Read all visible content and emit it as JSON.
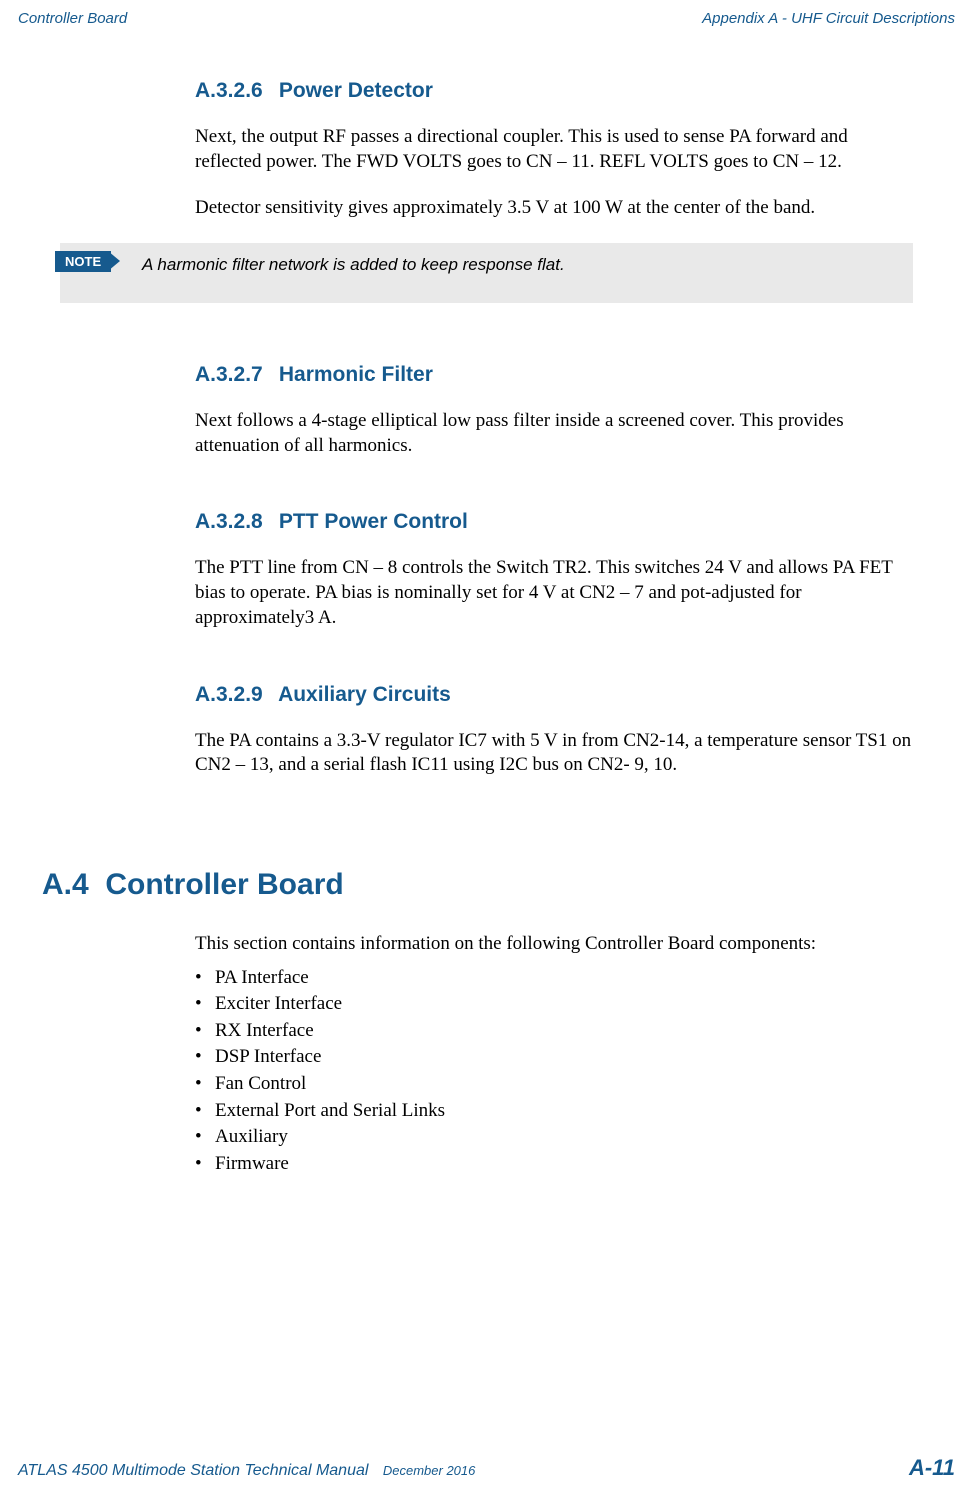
{
  "header": {
    "left": "Controller Board",
    "right": "Appendix A - UHF Circuit Descriptions"
  },
  "sections": {
    "s1": {
      "num": "A.3.2.6",
      "title": "Power Detector",
      "p1": "Next, the output RF passes a directional coupler. This is used to sense PA forward and reflected power. The FWD VOLTS goes to CN – 11. REFL VOLTS goes to CN – 12.",
      "p2": "Detector sensitivity gives approximately 3.5 V at 100 W at the center of the band."
    },
    "note": {
      "label": "NOTE",
      "text": "A harmonic filter network is added to keep response flat."
    },
    "s2": {
      "num": "A.3.2.7",
      "title": "Harmonic Filter",
      "p1": "Next follows a 4-stage elliptical low pass filter inside a screened cover. This provides attenuation of all harmonics."
    },
    "s3": {
      "num": "A.3.2.8",
      "title": "PTT Power Control",
      "p1": "The PTT line from CN – 8 controls the Switch TR2. This switches 24 V and allows PA FET bias to operate. PA bias is nominally set for 4 V at CN2 – 7 and pot-adjusted for approximately3 A."
    },
    "s4": {
      "num": "A.3.2.9",
      "title": "Auxiliary Circuits",
      "p1": "The PA contains a 3.3-V regulator IC7 with 5 V in from CN2-14, a temperature sensor TS1 on CN2 – 13, and a serial flash IC11 using I2C bus on CN2- 9, 10."
    },
    "chapter": {
      "num": "A.4",
      "title": "Controller Board",
      "intro": "This section contains information on the following Controller Board components:",
      "items": {
        "i0": "PA Interface",
        "i1": "Exciter Interface",
        "i2": "RX Interface",
        "i3": "DSP Interface",
        "i4": "Fan Control",
        "i5": "External Port and Serial Links",
        "i6": "Auxiliary",
        "i7": "Firmware"
      }
    }
  },
  "footer": {
    "manual": "ATLAS 4500 Multimode Station Technical Manual",
    "date": "December 2016",
    "page": "A-11"
  }
}
